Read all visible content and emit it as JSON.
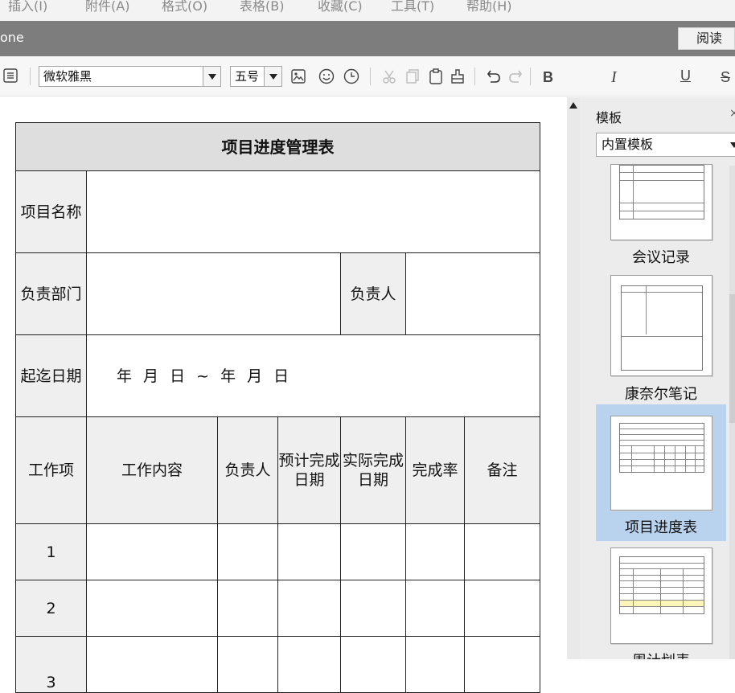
{
  "menu": [
    "插入(I)",
    "附件(A)",
    "格式(O)",
    "表格(B)",
    "收藏(C)",
    "工具(T)",
    "帮助(H)"
  ],
  "window": {
    "title": "one",
    "read_button": "阅读"
  },
  "toolbar": {
    "font_name": "微软雅黑",
    "font_size": "五号",
    "icons": [
      "list-icon",
      "image-icon",
      "emoji-icon",
      "clock-icon",
      "cut-icon",
      "copy-icon",
      "paste-icon",
      "format-painter-icon",
      "undo-icon",
      "redo-icon",
      "bold-icon",
      "italic-icon",
      "underline-icon",
      "strikethrough-icon"
    ],
    "glyphs": {
      "bold": "B",
      "italic": "I",
      "underline": "U",
      "strike": "S"
    }
  },
  "table": {
    "title": "项目进度管理表",
    "project_name_label": "项目名称",
    "dept_label": "负责部门",
    "owner_label": "负责人",
    "dates_label": "起迄日期",
    "date_range": "年 月 日 ~ 年 月 日",
    "headers": [
      "工作项",
      "工作内容",
      "负责人",
      "预计完成日期",
      "实际完成日期",
      "完成率",
      "备注"
    ],
    "rows": [
      "1",
      "2",
      "3"
    ]
  },
  "panel": {
    "title": "模板",
    "close": "×",
    "dropdown": "内置模板",
    "templates": [
      {
        "label": "会议记录",
        "selected": false
      },
      {
        "label": "康奈尔笔记",
        "selected": false
      },
      {
        "label": "项目进度表",
        "selected": true
      },
      {
        "label": "周计划表",
        "selected": false
      }
    ]
  }
}
